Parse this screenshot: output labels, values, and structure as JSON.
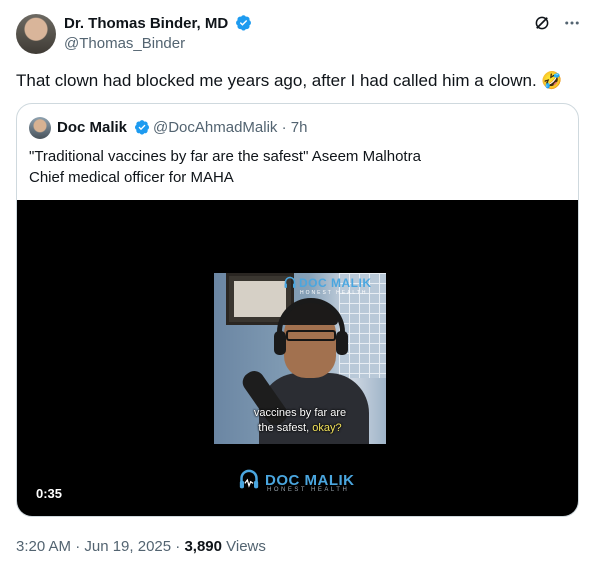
{
  "author": {
    "name": "Dr. Thomas Binder, MD",
    "handle": "@Thomas_Binder"
  },
  "tweet": {
    "text": "That clown had blocked me years ago, after I had called him a clown. 🤣"
  },
  "quote": {
    "name": "Doc Malik",
    "handle_time": "@DocAhmadMalik · 7h",
    "line1": "\"Traditional vaccines by far are the safest\" Aseem Malhotra",
    "line2": "Chief medical officer for MAHA",
    "video": {
      "duration": "0:35",
      "thumb_brand": "DOC MALIK",
      "thumb_brand_sub": "HONEST HEALTH",
      "caption_line1": "vaccines by far are",
      "caption_line2_a": "the safest, ",
      "caption_line2_b": "okay?",
      "logo_text": "DOC MALIK",
      "logo_sub": "HONEST HEALTH"
    }
  },
  "meta": {
    "time_date": "3:20 AM · Jun 19, 2025 · ",
    "views_count": "3,890",
    "views_label": " Views"
  },
  "colors": {
    "verified": "#1d9bf0",
    "brand_blue": "#4aa6df",
    "caption_highlight": "#f2e25a"
  },
  "icons": [
    "verified-badge-icon",
    "grok-icon",
    "more-icon",
    "headphone-logo-icon"
  ]
}
